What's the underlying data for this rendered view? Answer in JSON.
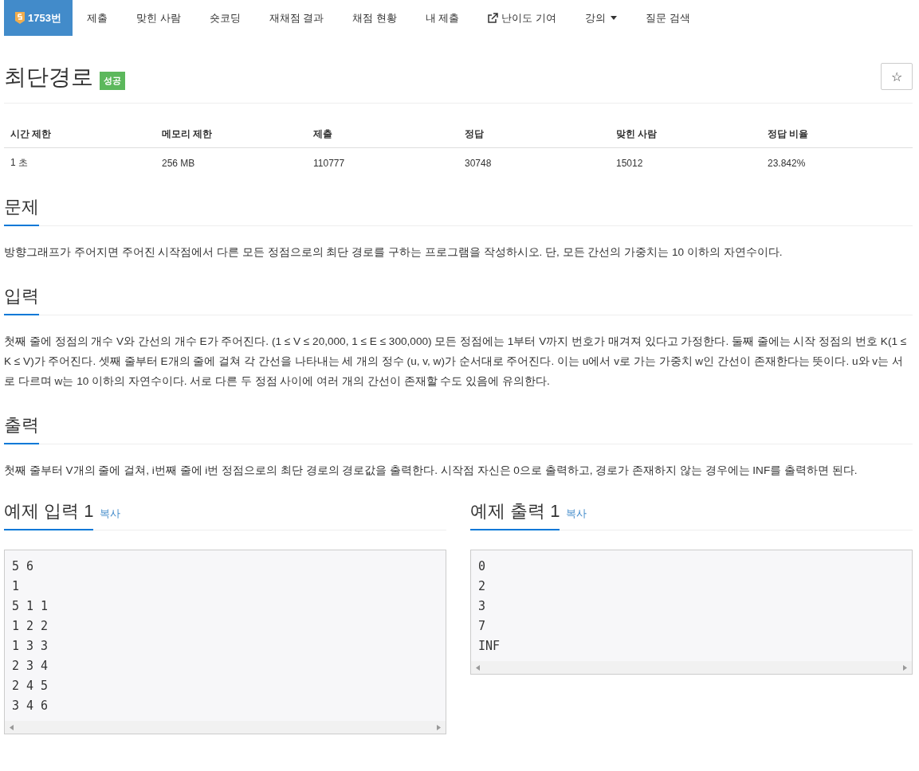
{
  "nav": {
    "items": [
      {
        "label": "1753번",
        "selected": true,
        "kind": "problem"
      },
      {
        "label": "제출",
        "selected": false,
        "kind": "plain"
      },
      {
        "label": "맞힌 사람",
        "selected": false,
        "kind": "plain"
      },
      {
        "label": "숏코딩",
        "selected": false,
        "kind": "plain"
      },
      {
        "label": "재채점 결과",
        "selected": false,
        "kind": "plain"
      },
      {
        "label": "채점 현황",
        "selected": false,
        "kind": "plain"
      },
      {
        "label": "내 제출",
        "selected": false,
        "kind": "plain"
      },
      {
        "label": "난이도 기여",
        "selected": false,
        "kind": "external"
      },
      {
        "label": "강의",
        "selected": false,
        "kind": "dropdown"
      },
      {
        "label": "질문 검색",
        "selected": false,
        "kind": "plain"
      }
    ]
  },
  "problem": {
    "title": "최단경로",
    "badge": "성공",
    "star": "☆"
  },
  "info_table": {
    "columns": [
      "시간 제한",
      "메모리 제한",
      "제출",
      "정답",
      "맞힌 사람",
      "정답 비율"
    ],
    "rows": [
      [
        "1 초",
        "256 MB",
        "110777",
        "30748",
        "15012",
        "23.842%"
      ]
    ]
  },
  "sections": [
    {
      "heading": "문제",
      "text": "방향그래프가 주어지면 주어진 시작점에서 다른 모든 정점으로의 최단 경로를 구하는 프로그램을 작성하시오. 단, 모든 간선의 가중치는 10 이하의 자연수이다."
    },
    {
      "heading": "입력",
      "text": "첫째 줄에 정점의 개수 V와 간선의 개수 E가 주어진다. (1 ≤ V ≤ 20,000, 1 ≤ E ≤ 300,000) 모든 정점에는 1부터 V까지 번호가 매겨져 있다고 가정한다. 둘째 줄에는 시작 정점의 번호 K(1 ≤ K ≤ V)가 주어진다. 셋째 줄부터 E개의 줄에 걸쳐 각 간선을 나타내는 세 개의 정수 (u, v, w)가 순서대로 주어진다. 이는 u에서 v로 가는 가중치 w인 간선이 존재한다는 뜻이다. u와 v는 서로 다르며 w는 10 이하의 자연수이다. 서로 다른 두 정점 사이에 여러 개의 간선이 존재할 수도 있음에 유의한다."
    },
    {
      "heading": "출력",
      "text": "첫째 줄부터 V개의 줄에 걸쳐, i번째 줄에 i번 정점으로의 최단 경로의 경로값을 출력한다. 시작점 자신은 0으로 출력하고, 경로가 존재하지 않는 경우에는 INF를 출력하면 된다."
    }
  ],
  "examples": [
    {
      "heading": "예제 입력 1",
      "copy": "복사",
      "lines": [
        "5 6",
        "1",
        "5 1 1",
        "1 2 2",
        "1 3 3",
        "2 3 4",
        "2 4 5",
        "3 4 6"
      ]
    },
    {
      "heading": "예제 출력 1",
      "copy": "복사",
      "lines": [
        "0",
        "2",
        "3",
        "7",
        "INF"
      ]
    }
  ]
}
